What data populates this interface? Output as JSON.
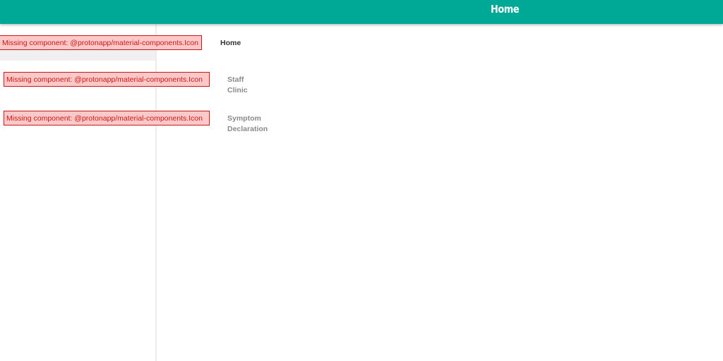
{
  "appbar": {
    "title": "Home"
  },
  "nav": {
    "missing_text": "Missing component: @protonapp/material-components.Icon",
    "items": [
      {
        "label": "Home",
        "active": true
      },
      {
        "label": "Staff\nClinic",
        "active": false
      },
      {
        "label": "Symptom\nDeclaration",
        "active": false
      }
    ]
  },
  "colors": {
    "primary": "#00a896",
    "error_bg": "#fcc8c8",
    "error_border": "#c81818"
  }
}
